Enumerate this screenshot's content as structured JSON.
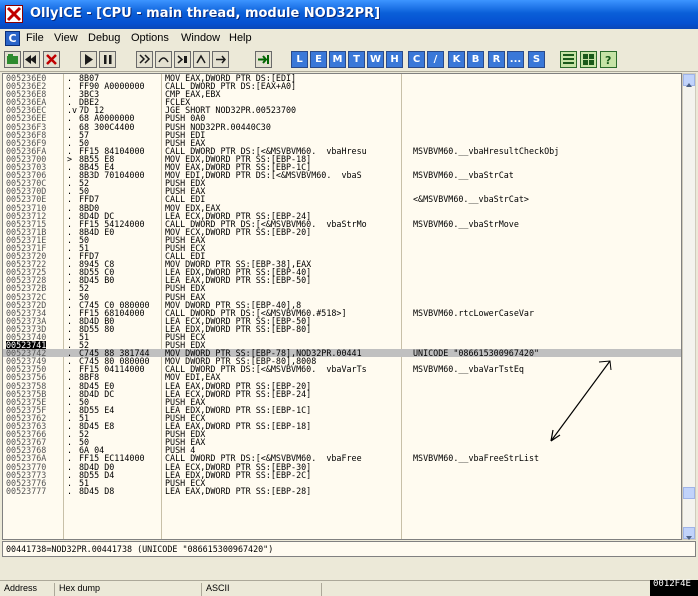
{
  "window": {
    "title": "OllyICE - [CPU - main thread, module NOD32PR]"
  },
  "menu": [
    "File",
    "View",
    "Debug",
    "Options",
    "Window",
    "Help"
  ],
  "toolbar": {
    "letters": [
      "L",
      "E",
      "M",
      "T",
      "W",
      "H",
      "C",
      "/",
      "K",
      "B",
      "R",
      "...",
      "S"
    ]
  },
  "disasm": [
    {
      "a": "005236E0",
      "m": ".",
      "h": "8B07",
      "i": "MOV EAX,DWORD PTR DS:[EDI]",
      "c": ""
    },
    {
      "a": "005236E2",
      "m": ".",
      "h": "FF90 A0000000",
      "i": "CALL DWORD PTR DS:[EAX+A0]",
      "c": ""
    },
    {
      "a": "005236E8",
      "m": ".",
      "h": "3BC3",
      "i": "CMP EAX,EBX",
      "c": ""
    },
    {
      "a": "005236EA",
      "m": ".",
      "h": "DBE2",
      "i": "FCLEX",
      "c": ""
    },
    {
      "a": "005236EC",
      "m": ".v",
      "h": "7D 12",
      "i": "JGE SHORT NOD32PR.00523700",
      "c": ""
    },
    {
      "a": "005236EE",
      "m": ".",
      "h": "68 A0000000",
      "i": "PUSH 0A0",
      "c": ""
    },
    {
      "a": "005236F3",
      "m": ".",
      "h": "68 300C4400",
      "i": "PUSH NOD32PR.00440C30",
      "c": ""
    },
    {
      "a": "005236F8",
      "m": ".",
      "h": "57",
      "i": "PUSH EDI",
      "c": ""
    },
    {
      "a": "005236F9",
      "m": ".",
      "h": "50",
      "i": "PUSH EAX",
      "c": ""
    },
    {
      "a": "005236FA",
      "m": ".",
      "h": "FF15 84104000",
      "i": "CALL DWORD PTR DS:[<&MSVBVM60.__vbaHresu",
      "c": "MSVBVM60.__vbaHresultCheckObj"
    },
    {
      "a": "00523700",
      "m": ">",
      "h": "8B55 E8",
      "i": "MOV EDX,DWORD PTR SS:[EBP-18]",
      "c": ""
    },
    {
      "a": "00523703",
      "m": ".",
      "h": "8B45 E4",
      "i": "MOV EAX,DWORD PTR SS:[EBP-1C]",
      "c": ""
    },
    {
      "a": "00523706",
      "m": ".",
      "h": "8B3D 70104000",
      "i": "MOV EDI,DWORD PTR DS:[<&MSVBVM60.__vbaS",
      "c": "MSVBVM60.__vbaStrCat"
    },
    {
      "a": "0052370C",
      "m": ".",
      "h": "52",
      "i": "PUSH EDX",
      "c": ""
    },
    {
      "a": "0052370D",
      "m": ".",
      "h": "50",
      "i": "PUSH EAX",
      "c": ""
    },
    {
      "a": "0052370E",
      "m": ".",
      "h": "FFD7",
      "i": "CALL EDI",
      "c": "<&MSVBVM60.__vbaStrCat>"
    },
    {
      "a": "00523710",
      "m": ".",
      "h": "8BD0",
      "i": "MOV EDX,EAX",
      "c": ""
    },
    {
      "a": "00523712",
      "m": ".",
      "h": "8D4D DC",
      "i": "LEA ECX,DWORD PTR SS:[EBP-24]",
      "c": ""
    },
    {
      "a": "00523715",
      "m": ".",
      "h": "FF15 54124000",
      "i": "CALL DWORD PTR DS:[<&MSVBVM60.__vbaStrMo",
      "c": "MSVBVM60.__vbaStrMove"
    },
    {
      "a": "0052371B",
      "m": ".",
      "h": "8B4D E0",
      "i": "MOV ECX,DWORD PTR SS:[EBP-20]",
      "c": ""
    },
    {
      "a": "0052371E",
      "m": ".",
      "h": "50",
      "i": "PUSH EAX",
      "c": ""
    },
    {
      "a": "0052371F",
      "m": ".",
      "h": "51",
      "i": "PUSH ECX",
      "c": ""
    },
    {
      "a": "00523720",
      "m": ".",
      "h": "FFD7",
      "i": "CALL EDI",
      "c": ""
    },
    {
      "a": "00523722",
      "m": ".",
      "h": "8945 C8",
      "i": "MOV DWORD PTR SS:[EBP-38],EAX",
      "c": ""
    },
    {
      "a": "00523725",
      "m": ".",
      "h": "8D55 C0",
      "i": "LEA EDX,DWORD PTR SS:[EBP-40]",
      "c": ""
    },
    {
      "a": "00523728",
      "m": ".",
      "h": "8D45 B0",
      "i": "LEA EAX,DWORD PTR SS:[EBP-50]",
      "c": ""
    },
    {
      "a": "0052372B",
      "m": ".",
      "h": "52",
      "i": "PUSH EDX",
      "c": ""
    },
    {
      "a": "0052372C",
      "m": ".",
      "h": "50",
      "i": "PUSH EAX",
      "c": ""
    },
    {
      "a": "0052372D",
      "m": ".",
      "h": "C745 C0 080000",
      "i": "MOV DWORD PTR SS:[EBP-40],8",
      "c": ""
    },
    {
      "a": "00523734",
      "m": ".",
      "h": "FF15 68104000",
      "i": "CALL DWORD PTR DS:[<&MSVBVM60.#518>]",
      "c": "MSVBVM60.rtcLowerCaseVar"
    },
    {
      "a": "0052373A",
      "m": ".",
      "h": "8D4D B0",
      "i": "LEA ECX,DWORD PTR SS:[EBP-50]",
      "c": ""
    },
    {
      "a": "0052373D",
      "m": ".",
      "h": "8D55 80",
      "i": "LEA EDX,DWORD PTR SS:[EBP-80]",
      "c": ""
    },
    {
      "a": "00523740",
      "m": ".",
      "h": "51",
      "i": "PUSH ECX",
      "c": ""
    },
    {
      "a": "00523741",
      "m": ".",
      "h": "52",
      "i": "PUSH EDX",
      "c": ""
    },
    {
      "a": "00523742",
      "m": ".",
      "h": "C745 88 381744",
      "i": "MOV DWORD PTR SS:[EBP-78],NOD32PR.00441",
      "c": "UNICODE \"086615300967420\""
    },
    {
      "a": "00523749",
      "m": ".",
      "h": "C745 80 080000",
      "i": "MOV DWORD PTR SS:[EBP-80],8008",
      "c": ""
    },
    {
      "a": "00523750",
      "m": ".",
      "h": "FF15 04114000",
      "i": "CALL DWORD PTR DS:[<&MSVBVM60.__vbaVarTs",
      "c": "MSVBVM60.__vbaVarTstEq"
    },
    {
      "a": "00523756",
      "m": ".",
      "h": "8BF8",
      "i": "MOV EDI,EAX",
      "c": ""
    },
    {
      "a": "00523758",
      "m": ".",
      "h": "8D45 E0",
      "i": "LEA EAX,DWORD PTR SS:[EBP-20]",
      "c": ""
    },
    {
      "a": "0052375B",
      "m": ".",
      "h": "8D4D DC",
      "i": "LEA ECX,DWORD PTR SS:[EBP-24]",
      "c": ""
    },
    {
      "a": "0052375E",
      "m": ".",
      "h": "50",
      "i": "PUSH EAX",
      "c": ""
    },
    {
      "a": "0052375F",
      "m": ".",
      "h": "8D55 E4",
      "i": "LEA EDX,DWORD PTR SS:[EBP-1C]",
      "c": ""
    },
    {
      "a": "00523762",
      "m": ".",
      "h": "51",
      "i": "PUSH ECX",
      "c": ""
    },
    {
      "a": "00523763",
      "m": ".",
      "h": "8D45 E8",
      "i": "LEA EAX,DWORD PTR SS:[EBP-18]",
      "c": ""
    },
    {
      "a": "00523766",
      "m": ".",
      "h": "52",
      "i": "PUSH EDX",
      "c": ""
    },
    {
      "a": "00523767",
      "m": ".",
      "h": "50",
      "i": "PUSH EAX",
      "c": ""
    },
    {
      "a": "00523768",
      "m": ".",
      "h": "6A 04",
      "i": "PUSH 4",
      "c": ""
    },
    {
      "a": "0052376A",
      "m": ".",
      "h": "FF15 EC114000",
      "i": "CALL DWORD PTR DS:[<&MSVBVM60.__vbaFree",
      "c": "MSVBVM60.__vbaFreeStrList"
    },
    {
      "a": "00523770",
      "m": ".",
      "h": "8D4D D0",
      "i": "LEA ECX,DWORD PTR SS:[EBP-30]",
      "c": ""
    },
    {
      "a": "00523773",
      "m": ".",
      "h": "8D55 D4",
      "i": "LEA EDX,DWORD PTR SS:[EBP-2C]",
      "c": ""
    },
    {
      "a": "00523776",
      "m": ".",
      "h": "51",
      "i": "PUSH ECX",
      "c": ""
    },
    {
      "a": "00523777",
      "m": ".",
      "h": "8D45 D8",
      "i": "LEA EAX,DWORD PTR SS:[EBP-28]",
      "c": ""
    }
  ],
  "highlight": {
    "current_row_index": 34,
    "address_marker_row_index": 33
  },
  "info": {
    "text": "00441738=NOD32PR.00441738 (UNICODE \"086615300967420\")"
  },
  "dump": {
    "columns": [
      "Address",
      "Hex dump",
      "ASCII"
    ],
    "stack_address": "0012F4E"
  }
}
